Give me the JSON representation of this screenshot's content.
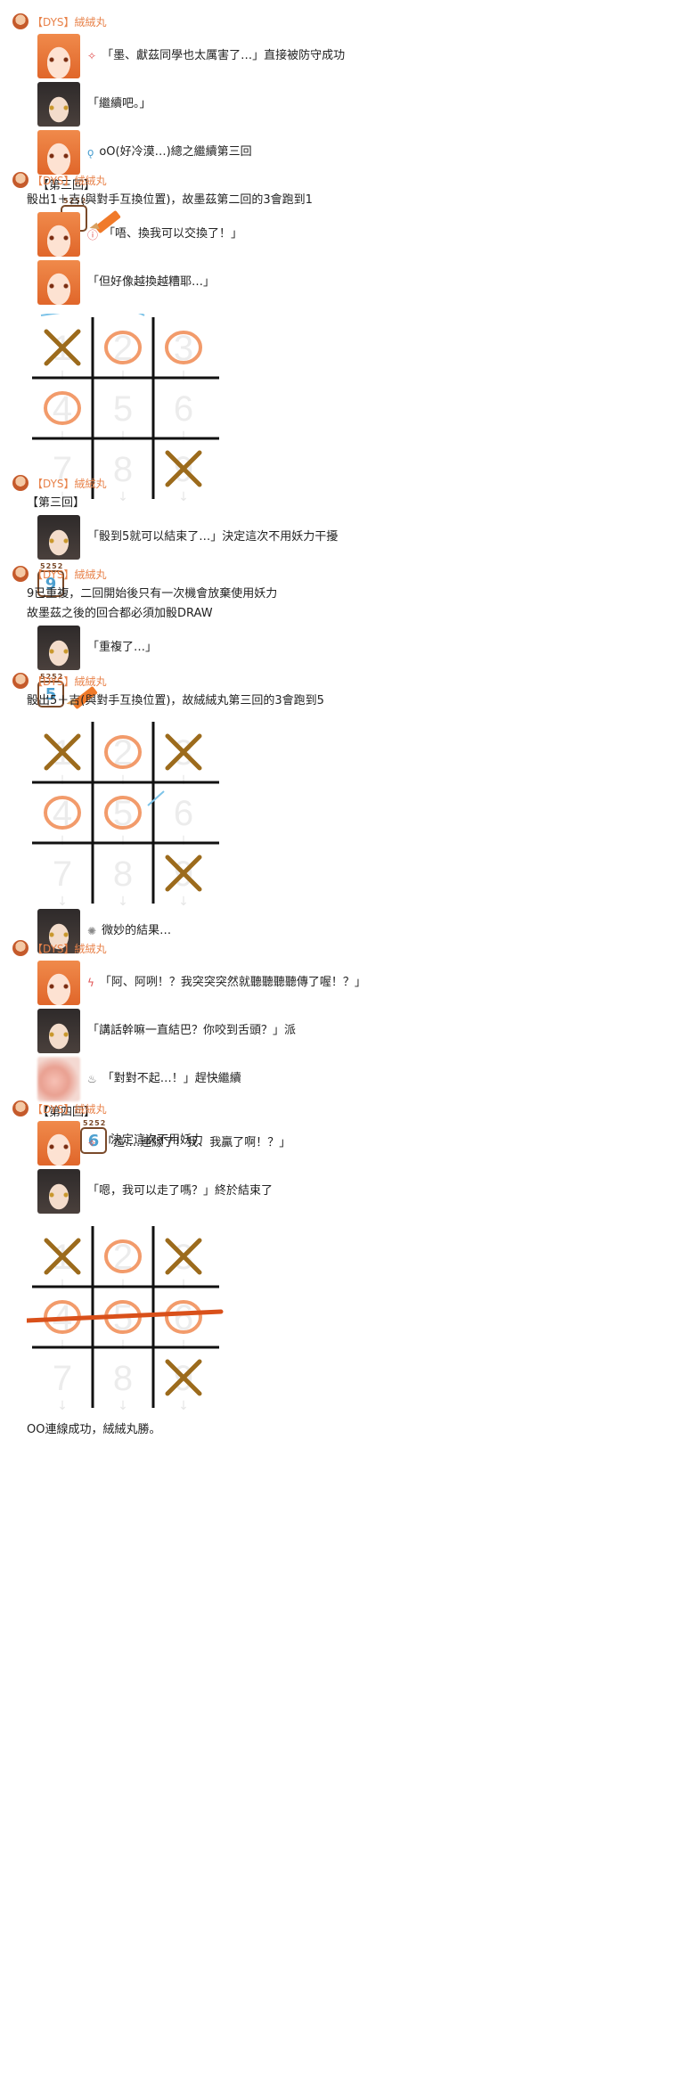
{
  "author": "【DYS】絨絨丸",
  "posts": [
    {
      "lines": [
        {
          "text": "「墨、獻茲同學也太厲害了…」直接被防守成功"
        },
        {
          "text": "「繼續吧。」"
        },
        {
          "text": "oO(好冷漠…)總之繼續第三回"
        }
      ],
      "round_label": "【第三回】",
      "die_tag": "5252",
      "die_value": "1"
    },
    {
      "desc": "骰出1＋吉(與對手互換位置)，故墨茲第二回的3會跑到1",
      "lines": [
        {
          "text": "「唔、換我可以交換了！」"
        },
        {
          "text": "「但好像越換越糟耶…」"
        }
      ],
      "board_numbers": [
        "1",
        "2",
        "3",
        "4",
        "5",
        "6",
        "7",
        "8",
        "9"
      ],
      "board_marks": [
        "X",
        "O",
        "O",
        "O",
        "",
        "",
        "",
        "",
        "X"
      ]
    },
    {
      "round_label": "【第三回】",
      "lines": [
        {
          "text": "「骰到5就可以結束了…」決定這次不用妖力干擾"
        }
      ],
      "die_tag": "5252",
      "die_value": "9"
    },
    {
      "desc1": "9已重複，二回開始後只有一次機會放棄使用妖力",
      "desc2": "故墨茲之後的回合都必須加骰DRAW",
      "lines": [
        {
          "text": "「重複了…」"
        }
      ],
      "die_tag": "5252",
      "die_value": "5"
    },
    {
      "desc": "骰出5＋吉(與對手互換位置)，故絨絨丸第三回的3會跑到5",
      "board_marks": [
        "X",
        "O",
        "X",
        "O",
        "O",
        "",
        "",
        "",
        "X"
      ],
      "lines": [
        {
          "text": "微妙的結果…"
        }
      ]
    },
    {
      "lines": [
        {
          "text": "「阿、阿咧！？我突突突然就聽聽聽聽傳了喔！？」"
        },
        {
          "text": "「講話幹嘛一直結巴？你咬到舌頭？」派"
        },
        {
          "text": "「對對不起…！」趕快繼續"
        }
      ],
      "round_label": "【第四回】",
      "die_tag": "5252",
      "die_value": "6",
      "after_die": "決定這次不用妖力"
    },
    {
      "lines": [
        {
          "text": "「這….連線了！我、我贏了啊！？」"
        },
        {
          "text": "「嗯，我可以走了嗎？」終於結束了"
        }
      ],
      "board_marks": [
        "X",
        "O",
        "X",
        "O",
        "O",
        "O",
        "",
        "",
        "X"
      ],
      "ending": "OO連線成功，絨絨丸勝。"
    }
  ],
  "colors": {
    "author": "#e8824a",
    "x_mark": "#9c6b1c",
    "o_mark": "#f29b6b",
    "arrow": "#7cc3e8",
    "win_line": "#d9501a",
    "grid": "#111111"
  }
}
